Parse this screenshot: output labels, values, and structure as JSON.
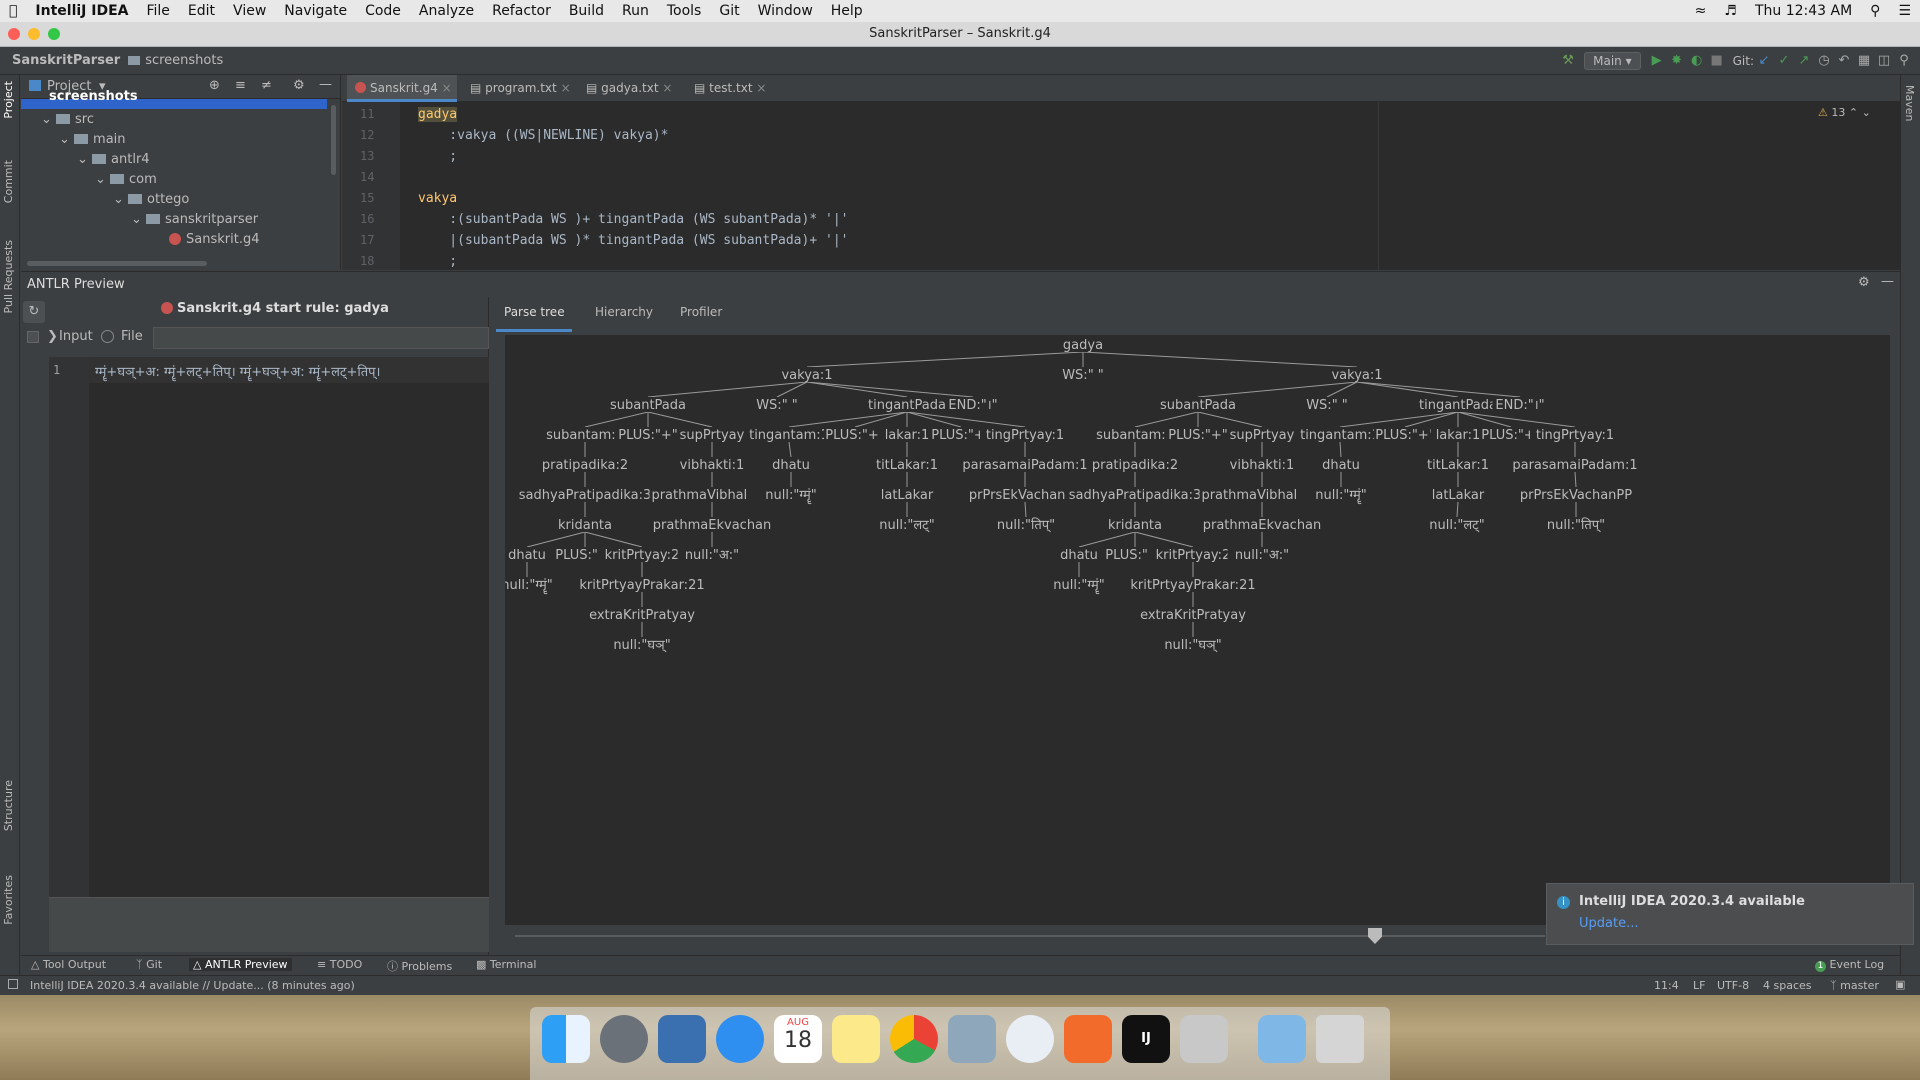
{
  "menubar": {
    "app": "IntelliJ IDEA",
    "items": [
      "File",
      "Edit",
      "View",
      "Navigate",
      "Code",
      "Analyze",
      "Refactor",
      "Build",
      "Run",
      "Tools",
      "Git",
      "Window",
      "Help"
    ],
    "clock": "Thu 12:43 AM"
  },
  "window": {
    "title": "SanskritParser – Sanskrit.g4"
  },
  "nav": {
    "project": "SanskritParser",
    "folder": "screenshots",
    "run_config": "Main",
    "git_label": "Git:"
  },
  "project_panel": {
    "title": "Project",
    "items": [
      {
        "label": "screenshots",
        "depth": 1
      },
      {
        "label": "src",
        "depth": 1
      },
      {
        "label": "main",
        "depth": 2
      },
      {
        "label": "antlr4",
        "depth": 3
      },
      {
        "label": "com",
        "depth": 4
      },
      {
        "label": "ottego",
        "depth": 5
      },
      {
        "label": "sanskritparser",
        "depth": 6
      },
      {
        "label": "Sanskrit.g4",
        "depth": 7
      }
    ]
  },
  "editor_tabs": [
    "Sanskrit.g4",
    "program.txt",
    "gadya.txt",
    "test.txt"
  ],
  "editor": {
    "warnings": "13",
    "lines": [
      {
        "n": "11",
        "text": "gadya"
      },
      {
        "n": "12",
        "text": "    :vakya ((WS|NEWLINE) vakya)*"
      },
      {
        "n": "13",
        "text": "    ;"
      },
      {
        "n": "14",
        "text": ""
      },
      {
        "n": "15",
        "text": "vakya"
      },
      {
        "n": "16",
        "text": "    :(subantPada WS )+ tingantPada (WS subantPada)* '|'"
      },
      {
        "n": "17",
        "text": "    |(subantPada WS )* tingantPada (WS subantPada)+ '|'"
      },
      {
        "n": "18",
        "text": "    ;"
      }
    ]
  },
  "antlr": {
    "title": "ANTLR Preview",
    "start_rule": "Sanskrit.g4 start rule: gadya",
    "input_label": "Input",
    "file_label": "File",
    "input_line_no": "1",
    "input_text": "ग्मॄं+घञ्+अ: ग्मॄं+लट्+तिप्। ग्मॄं+घञ्+अ: ग्मॄं+लट्+तिप्।",
    "tabs": [
      "Parse tree",
      "Hierarchy",
      "Profiler"
    ]
  },
  "parse_tree": {
    "nodes": [
      "gadya",
      "vakya:1",
      "WS:\" \"",
      "vakya:1",
      "subantPada",
      "WS:\" \"",
      "tingantPada",
      "END:\"।\"",
      "subantPada",
      "WS:\" \"",
      "tingantPada",
      "END:\"।\"",
      "subantam:1",
      "PLUS:\"+\"",
      "supPrtyay",
      "tingantam:1",
      "PLUS:\"+\"",
      "lakar:1",
      "PLUS:\"+\"",
      "tingPrtyay:1",
      "subantam:1",
      "PLUS:\"+\"",
      "supPrtyay",
      "tingantam:1",
      "PLUS:\"+\"",
      "lakar:1",
      "PLUS:\"+\"",
      "tingPrtyay:1",
      "pratipadika:2",
      "vibhakti:1",
      "dhatu",
      "titLakar:1",
      "parasamaiPadam:1",
      "pratipadika:2",
      "vibhakti:1",
      "dhatu",
      "titLakar:1",
      "parasamaiPadam:1",
      "sadhyaPratipadika:3",
      "prathmaVibhakti:1",
      "null:\"ग्मॄं\"",
      "latLakar",
      "prPrsEkVachanPP",
      "sadhyaPratipadika:3",
      "prathmaVibhakti:1",
      "null:\"ग्मॄं\"",
      "latLakar",
      "prPrsEkVachanPP",
      "kridanta",
      "prathmaEkvachan",
      "null:\"लट्\"",
      "null:\"तिप्\"",
      "kridanta",
      "prathmaEkvachan",
      "null:\"लट्\"",
      "null:\"तिप्\"",
      "dhatu",
      "PLUS:\"+\"",
      "kritPrtyay:2",
      "null:\"अ:\"",
      "dhatu",
      "PLUS:\"+\"",
      "kritPrtyay:2",
      "null:\"अ:\"",
      "null:\"ग्मॄं\"",
      "kritPrtyayPrakar:21",
      "null:\"ग्मॄं\"",
      "kritPrtyayPrakar:21",
      "extraKritPratyay",
      "extraKritPratyay",
      "null:\"घञ्\"",
      "null:\"घञ्\""
    ]
  },
  "tool_windows": [
    "Tool Output",
    "Git",
    "ANTLR Preview",
    "TODO",
    "Problems",
    "Terminal",
    "Event Log"
  ],
  "event_log_count": "1",
  "notification": {
    "title": "IntelliJ IDEA 2020.3.4 available",
    "link": "Update..."
  },
  "status": {
    "message": "IntelliJ IDEA 2020.3.4 available // Update... (8 minutes ago)",
    "position": "11:4",
    "line_sep": "LF",
    "encoding": "UTF-8",
    "indent": "4 spaces",
    "branch": "master"
  },
  "left_tabs": [
    "Project",
    "Commit",
    "Pull Requests",
    "Structure",
    "Favorites"
  ],
  "right_tabs": [
    "Maven"
  ],
  "dock": {
    "calendar_month": "AUG",
    "calendar_day": "18"
  }
}
